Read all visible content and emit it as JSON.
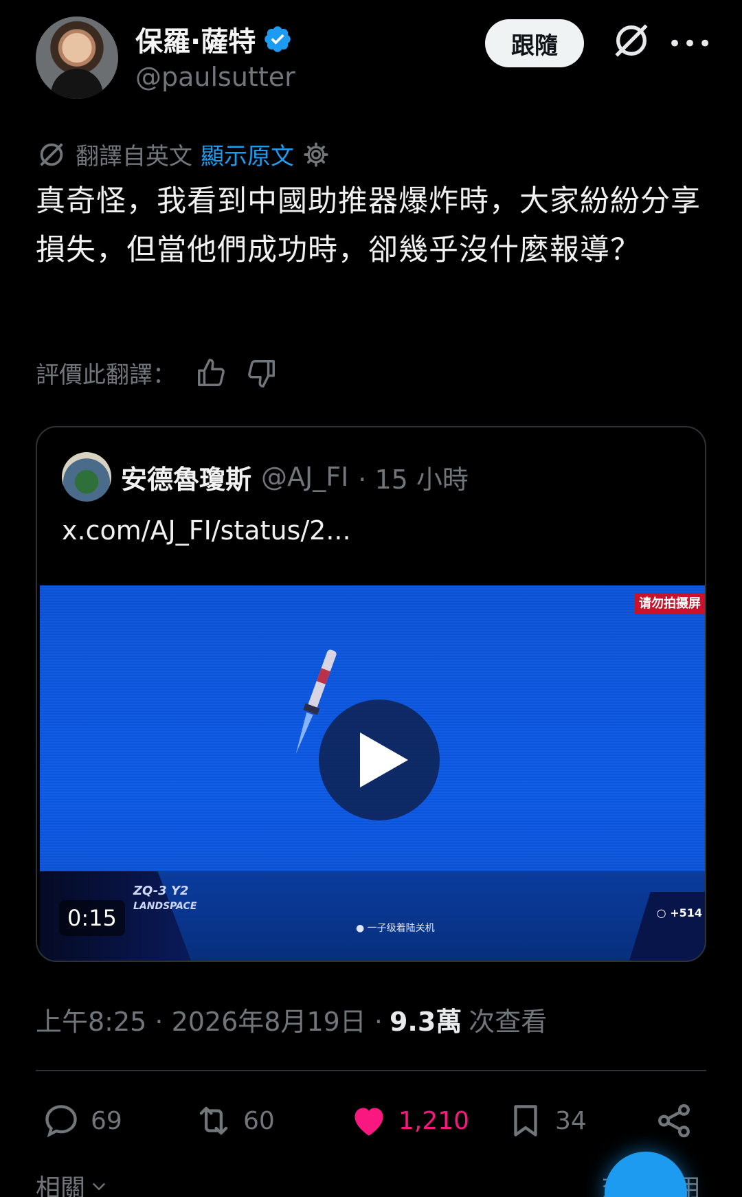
{
  "author": {
    "display_name": "保羅·薩特",
    "handle": "@paulsutter",
    "verified": true,
    "follow_label": "跟隨"
  },
  "icons": {
    "verified": "verified-badge-icon",
    "grok": "grok-icon",
    "more": "more-icon",
    "gear": "gear-icon",
    "thumbs_up": "thumbs-up-icon",
    "thumbs_down": "thumbs-down-icon",
    "reply": "reply-icon",
    "repost": "repost-icon",
    "like": "heart-icon",
    "bookmark": "bookmark-icon",
    "share": "share-icon",
    "play": "play-icon"
  },
  "colors": {
    "accent": "#1d9bf0",
    "like": "#f91880",
    "muted": "#71767b"
  },
  "translation": {
    "label": "翻譯自英文",
    "show_original": "顯示原文",
    "rate_label": "評價此翻譯："
  },
  "tweet": {
    "text": "真奇怪，我看到中國助推器爆炸時，大家紛紛分享損失，但當他們成功時，卻幾乎沒什麼報導？"
  },
  "quoted": {
    "name": "安德魯瓊斯",
    "handle": "@AJ_FI",
    "time": "· 15 小時",
    "link_text": "x.com/AJ_FI/status/2...",
    "video": {
      "duration": "0:15",
      "badge": "请勿拍摄屏",
      "overlay_left": "ZQ-3 Y2",
      "overlay_left_sub": "LANDSPACE",
      "overlay_center": "● 一子级着陆关机",
      "overlay_right": "○ +514"
    }
  },
  "meta": {
    "time": "上午8:25 · 2026年8月19日 ·",
    "views": "9.3萬",
    "views_label": "次查看"
  },
  "actions": {
    "replies": "69",
    "reposts": "60",
    "likes": "1,210",
    "bookmarks": "34"
  },
  "footer": {
    "related": "相關",
    "view_quotes": "查看引用"
  }
}
